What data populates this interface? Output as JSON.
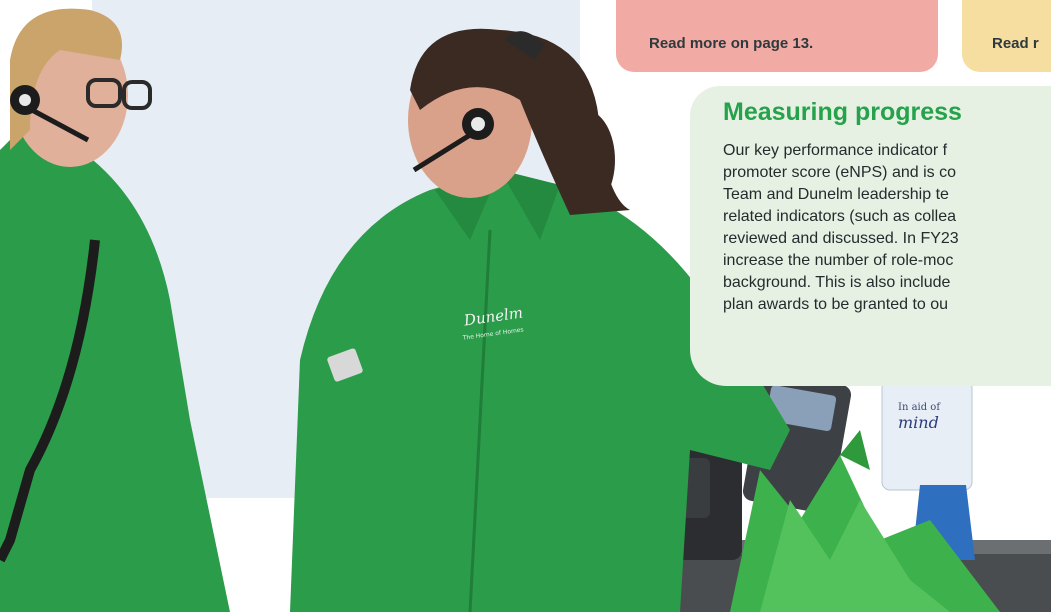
{
  "cards": [
    {
      "link": "Read more on page 13.",
      "color": "#f2aaa4"
    },
    {
      "link": "Read r",
      "color": "#f6dea1"
    }
  ],
  "progress": {
    "title": "Measuring progress",
    "lines": [
      "Our key performance indicator f",
      "promoter score (eNPS) and is co",
      "Team and Dunelm leadership te",
      "related indicators (such as collea",
      "reviewed and discussed. In FY23",
      "increase the number of role-moc",
      "background. This is also include",
      "plan awards to be granted to ou"
    ]
  },
  "photo": {
    "fleece_logo": "Dunelm",
    "fleece_tagline": "The Home of Homes",
    "name_badge": "",
    "charity_tag": "In aid of",
    "charity_name": "mind",
    "colors": {
      "fleece": "#2a9c4a",
      "panel_green": "#e6f1e4",
      "heading_green": "#25a24a"
    }
  }
}
